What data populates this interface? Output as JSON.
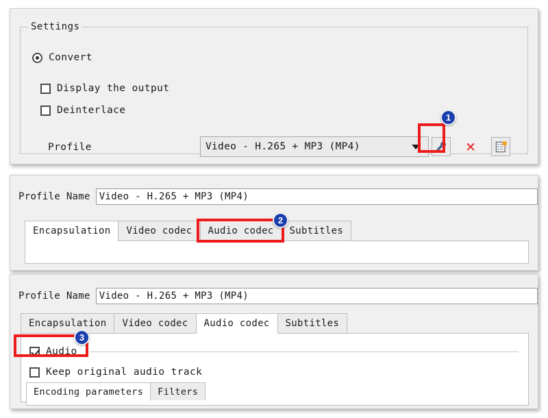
{
  "settings_panel": {
    "group_title": "Settings",
    "convert_label": "Convert",
    "display_output_label": "Display the output",
    "deinterlace_label": "Deinterlace",
    "profile_label": "Profile",
    "profile_value": "Video - H.265 + MP3 (MP4)",
    "buttons": {
      "edit_profile": "wrench-icon",
      "delete_profile": "✕",
      "new_profile": "new-profile-icon"
    }
  },
  "profile_panel_a": {
    "profile_name_label": "Profile Name",
    "profile_name_value": "Video - H.265 + MP3 (MP4)",
    "tabs": [
      {
        "label": "Encapsulation",
        "active": true
      },
      {
        "label": "Video codec",
        "active": false
      },
      {
        "label": "Audio codec",
        "active": false
      },
      {
        "label": "Subtitles",
        "active": false
      }
    ]
  },
  "profile_panel_b": {
    "profile_name_label": "Profile Name",
    "profile_name_value": "Video - H.265 + MP3 (MP4)",
    "tabs": [
      {
        "label": "Encapsulation",
        "active": false
      },
      {
        "label": "Video codec",
        "active": false
      },
      {
        "label": "Audio codec",
        "active": true
      },
      {
        "label": "Subtitles",
        "active": false
      }
    ],
    "audio_label": "Audio",
    "keep_original_label": "Keep original audio track",
    "sub_tabs": [
      {
        "label": "Encoding parameters",
        "active": true
      },
      {
        "label": "Filters",
        "active": false
      }
    ]
  },
  "annotations": {
    "badges": [
      "1",
      "2",
      "3"
    ],
    "highlight_color": "#ee1b1b",
    "badge_color": "#1b3fae"
  }
}
